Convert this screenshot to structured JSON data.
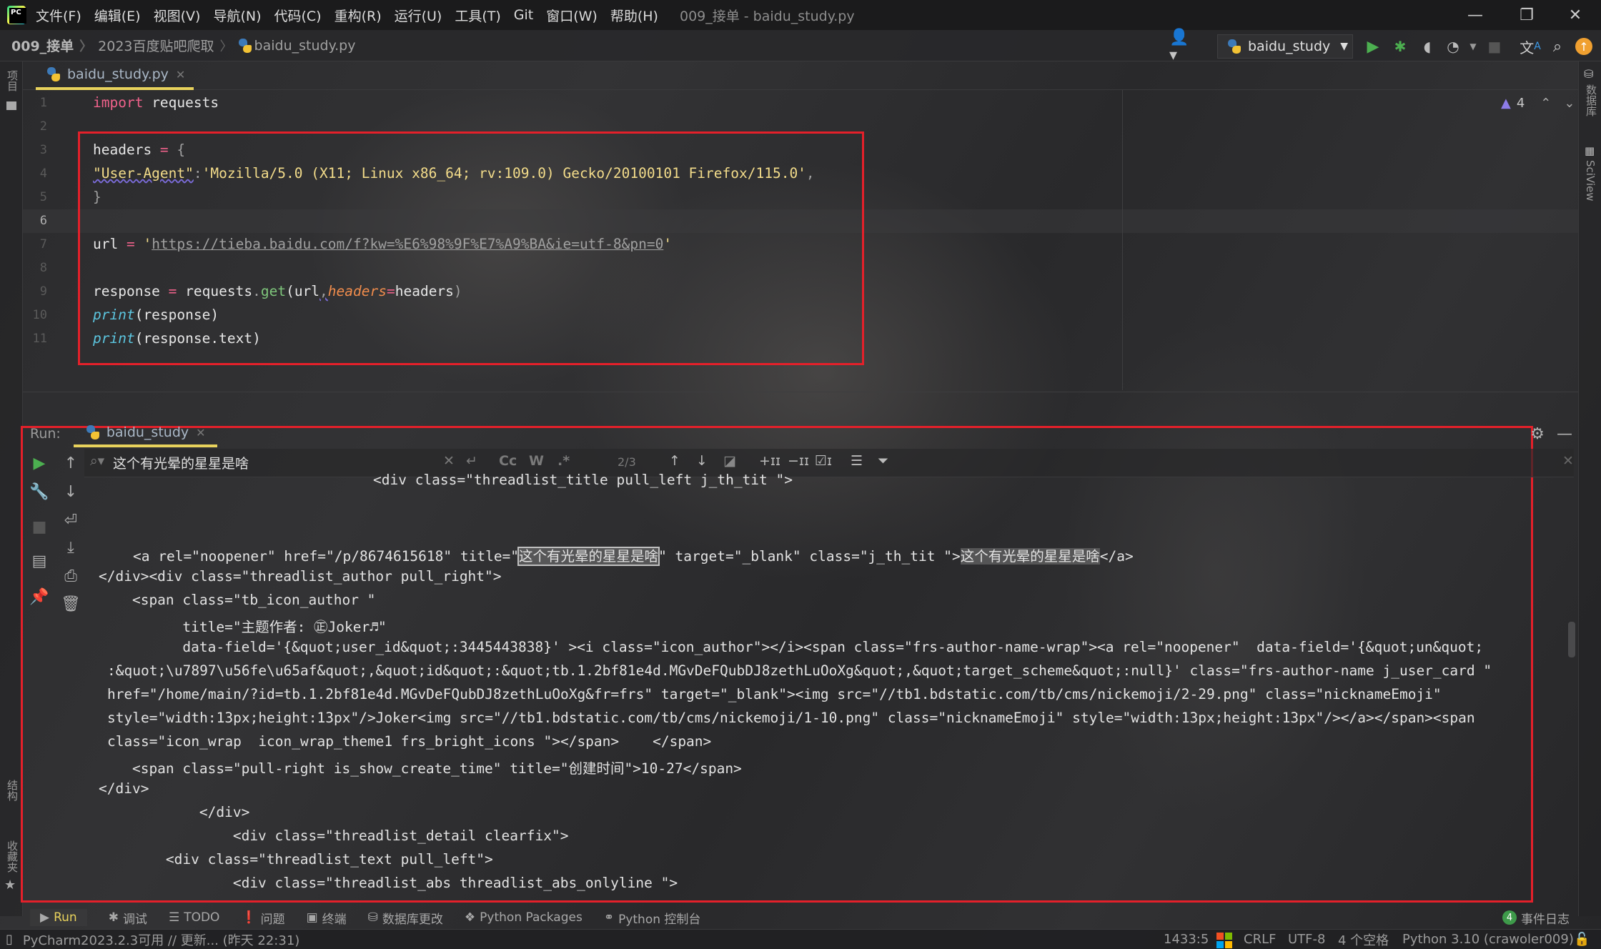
{
  "window": {
    "title": "009_接单 - baidu_study.py",
    "menu": [
      "文件(F)",
      "编辑(E)",
      "视图(V)",
      "导航(N)",
      "代码(C)",
      "重构(R)",
      "运行(U)",
      "工具(T)",
      "Git",
      "窗口(W)",
      "帮助(H)"
    ],
    "controls": {
      "minimize": "—",
      "restore": "❐",
      "close": "✕"
    }
  },
  "breadcrumb": [
    "009_接单",
    "2023百度贴吧爬取",
    "baidu_study.py"
  ],
  "toolbar": {
    "run_config": "baidu_study",
    "icons": [
      "user-icon",
      "run-icon",
      "debug-icon",
      "coverage-icon",
      "profile-icon",
      "stop-icon",
      "translate-icon",
      "search-icon",
      "update-icon"
    ]
  },
  "left_strip": {
    "project": "项目",
    "structure": "结构",
    "favorites": "收藏夹"
  },
  "right_strip": {
    "database": "数据库",
    "sciview": "SciView"
  },
  "editor": {
    "tab": "baidu_study.py",
    "warnings_count": "4",
    "line_numbers": [
      "1",
      "2",
      "3",
      "4",
      "5",
      "6",
      "7",
      "8",
      "9",
      "10",
      "11"
    ],
    "current_line": "6",
    "lines": {
      "l1_kw": "import",
      "l1_rest": " requests",
      "l3_a": "headers ",
      "l3_op": "=",
      "l3_b": " {",
      "l4_key": "\"User-Agent\"",
      "l4_colon": ":",
      "l4_val": "'Mozilla/5.0 (X11; Linux x86_64; rv:109.0) Gecko/20100101 Firefox/115.0'",
      "l4_comma": ",",
      "l5": "}",
      "l7_a": "url ",
      "l7_op": "=",
      "l7_q1": " '",
      "l7_url": "https://tieba.baidu.com/f?kw=%E6%98%9F%E7%A9%BA&ie=utf-8&pn=0",
      "l7_q2": "'",
      "l9_a": "response ",
      "l9_op": "=",
      "l9_b": " requests",
      "l9_dot": ".",
      "l9_fn": "get",
      "l9_c": "(url",
      "l9_comma": ",",
      "l9_param": "headers",
      "l9_eq": "=",
      "l9_d": "headers",
      "l9_close": ")",
      "l10_fn": "print",
      "l10_rest": "(response)",
      "l11_fn": "print",
      "l11_rest": "(response.text)"
    }
  },
  "run_panel": {
    "label": "Run:",
    "tab": "baidu_study",
    "search_value": "这个有光晕的星星是啥",
    "match_count": "2/3",
    "search_opts": {
      "cc": "Cc",
      "w": "W",
      "regex": ".*"
    },
    "console": [
      "<div class=\"threadlist_title pull_left j_th_tit \">",
      "",
      "",
      {
        "pre": "<a rel=\"noopener\" href=\"/p/8674615618\" title=\"",
        "m1": "这个有光晕的星星是啥",
        "mid": "\" target=\"_blank\" class=\"j_th_tit \">",
        "m2": "这个有光晕的星星是啥",
        "post": "</a>"
      },
      "</div><div class=\"threadlist_author pull_right\">",
      "    <span class=\"tb_icon_author \"",
      "          title=\"主题作者: ㊣Joker♬\"",
      "          data-field='{&quot;user_id&quot;:3445443838}' ><i class=\"icon_author\"></i><span class=\"frs-author-name-wrap\"><a rel=\"noopener\"  data-field='{&quot;un&quot;",
      ":&quot;\\u7897\\u56fe\\u65af&quot;,&quot;id&quot;:&quot;tb.1.2bf81e4d.MGvDeFQubDJ8zethLuOoXg&quot;,&quot;target_scheme&quot;:null}' class=\"frs-author-name j_user_card \"",
      "href=\"/home/main/?id=tb.1.2bf81e4d.MGvDeFQubDJ8zethLuOoXg&fr=frs\" target=\"_blank\"><img src=\"//tb1.bdstatic.com/tb/cms/nickemoji/2-29.png\" class=\"nicknameEmoji\"",
      "style=\"width:13px;height:13px\"/>Joker<img src=\"//tb1.bdstatic.com/tb/cms/nickemoji/1-10.png\" class=\"nicknameEmoji\" style=\"width:13px;height:13px\"/></a></span><span",
      "class=\"icon_wrap  icon_wrap_theme1 frs_bright_icons \"></span>    </span>",
      "    <span class=\"pull-right is_show_create_time\" title=\"创建时间\">10-27</span>",
      "</div>",
      "            </div>",
      "                <div class=\"threadlist_detail clearfix\">",
      "        <div class=\"threadlist_text pull_left\">",
      "                <div class=\"threadlist_abs threadlist_abs_onlyline \">"
    ]
  },
  "bottom_tools": [
    "Run",
    "调试",
    "TODO",
    "问题",
    "终端",
    "数据库更改",
    "Python Packages",
    "Python 控制台"
  ],
  "event_log": {
    "count": "4",
    "label": "事件日志"
  },
  "status": {
    "message": "PyCharm2023.2.3可用 // 更新... (昨天 22:31)",
    "position": "1433:5",
    "line_sep": "CRLF",
    "encoding": "UTF-8",
    "indent": "4 个空格",
    "interpreter": "Python 3.10 (crawoler009)"
  },
  "colors": {
    "highlight_box": "#e4202a",
    "tab_underline": "#e8d25c",
    "run_green": "#4caf50"
  }
}
